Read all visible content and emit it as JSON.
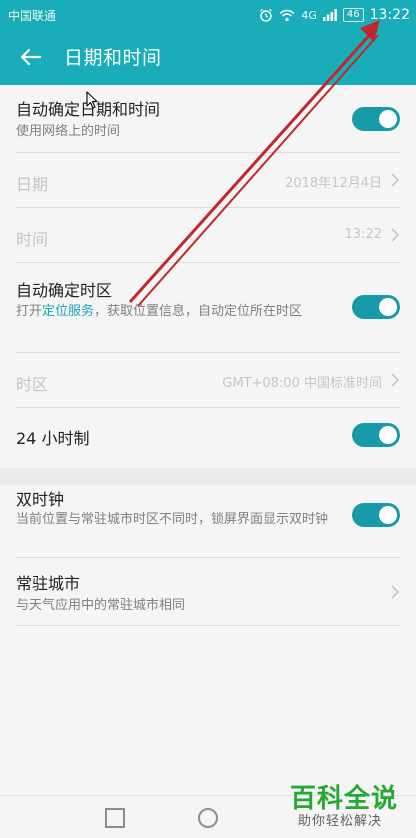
{
  "status_bar": {
    "carrier": "中国联通",
    "signal": "4G",
    "battery": "46",
    "time": "13:22"
  },
  "header": {
    "title": "日期和时间",
    "back_icon": "arrow-left-icon"
  },
  "settings": {
    "auto_datetime": {
      "title": "自动确定日期和时间",
      "desc": "使用网络上的时间",
      "toggle": true
    },
    "date": {
      "title": "日期",
      "value": "2018年12月4日"
    },
    "time": {
      "title": "时间",
      "value": "13:22"
    },
    "auto_timezone": {
      "title": "自动确定时区",
      "desc_prefix": "打开",
      "desc_link": "定位服务",
      "desc_suffix": "，获取位置信息，自动定位所在时区",
      "toggle": true
    },
    "timezone": {
      "title": "时区",
      "value": "GMT+08:00 中国标准时间"
    },
    "hour24": {
      "title": "24 小时制",
      "toggle": true
    },
    "dual_clock": {
      "title": "双时钟",
      "desc": "当前位置与常驻城市时区不同时，锁屏界面显示双时钟",
      "toggle": true
    },
    "home_city": {
      "title": "常驻城市",
      "desc": "与天气应用中的常驻城市相同"
    }
  },
  "watermark": {
    "main": "百科全说",
    "sub": "助你轻松解决"
  },
  "colors": {
    "accent": "#18adb9",
    "toggle_on": "#189ba8",
    "annotation_arrow": "#c0282e",
    "watermark": "#25a834"
  }
}
